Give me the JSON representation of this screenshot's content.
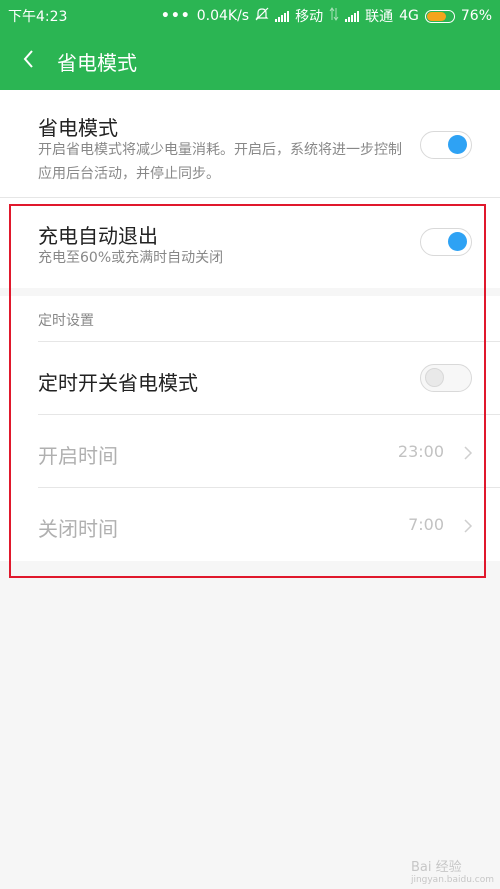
{
  "status_bar": {
    "time": "下午4:23",
    "dots": "•••",
    "speed": "0.04K/s",
    "carrier1": "移动",
    "carrier2": "联通",
    "network": "4G",
    "battery_percent": "76%",
    "battery_level": 0.76
  },
  "toolbar": {
    "title": "省电模式"
  },
  "power_saving": {
    "title": "省电模式",
    "description": "开启省电模式将减少电量消耗。开启后，系统将进一步控制应用后台活动，并停止同步。",
    "enabled": true
  },
  "auto_exit": {
    "title": "充电自动退出",
    "description": "充电至60%或充满时自动关闭",
    "enabled": true
  },
  "schedule": {
    "section_label": "定时设置",
    "toggle_title": "定时开关省电模式",
    "enabled": false,
    "start": {
      "label": "开启时间",
      "value": "23:00"
    },
    "end": {
      "label": "关闭时间",
      "value": "7:00"
    }
  },
  "watermark": {
    "text": "Bai 经验",
    "sub": "jingyan.baidu.com"
  },
  "colors": {
    "accent": "#2bb553",
    "switch_on": "#2ea2f4",
    "highlight": "#e0182c"
  }
}
